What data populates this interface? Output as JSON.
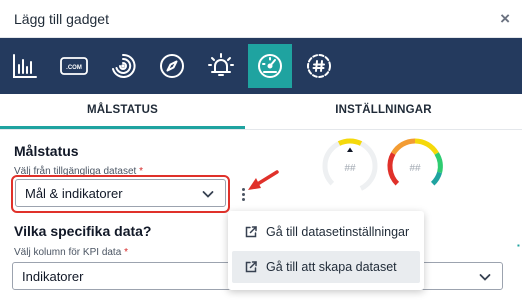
{
  "dialog": {
    "title": "Lägg till gadget",
    "close_glyph": "×"
  },
  "gadget_icons": [
    {
      "name": "bar-chart-icon",
      "active": false
    },
    {
      "name": "web-address-icon",
      "label": ".COM",
      "active": false
    },
    {
      "name": "signal-waves-icon",
      "active": false
    },
    {
      "name": "compass-icon",
      "active": false
    },
    {
      "name": "alert-bell-icon",
      "active": false
    },
    {
      "name": "speedometer-icon",
      "active": true
    },
    {
      "name": "hashtag-icon",
      "active": false
    }
  ],
  "tabs": [
    {
      "label": "MÅLSTATUS",
      "active": true
    },
    {
      "label": "INSTÄLLNINGAR",
      "active": false
    }
  ],
  "goal_status": {
    "heading": "Målstatus",
    "dataset_label": "Välj från tillgängliga dataset",
    "required_mark": "*",
    "dataset_value": "Mål & indikatorer"
  },
  "specific_data": {
    "heading": "Vilka specifika data?",
    "kpi_label": "Välj kolumn för KPI data",
    "required_mark": "*",
    "kpi_value": "Indikatorer"
  },
  "gauges": [
    {
      "text": "##"
    },
    {
      "text": "##"
    }
  ],
  "context_menu": {
    "items": [
      {
        "label": "Gå till datasetinställningar",
        "icon": "external-link-icon"
      },
      {
        "label": "Gå till att skapa dataset",
        "icon": "external-link-icon"
      }
    ]
  },
  "colors": {
    "header_bg": "#243a5e",
    "accent": "#1fa3a0",
    "highlight": "#e0312a"
  }
}
